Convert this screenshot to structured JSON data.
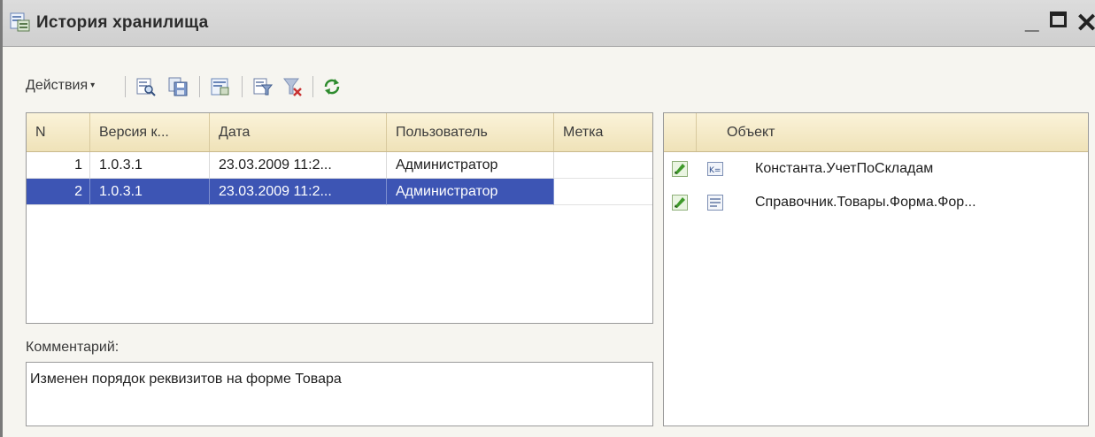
{
  "window": {
    "title": "История хранилища",
    "minimize": "_",
    "close": "✕"
  },
  "toolbar": {
    "actions_label": "Действия",
    "actions_caret": "▾",
    "icons": [
      "view-version-icon",
      "save-version-icon",
      "report-icon",
      "filter-icon",
      "clear-filter-icon",
      "refresh-icon"
    ]
  },
  "versions_table": {
    "columns": [
      "N",
      "Версия к...",
      "Дата",
      "Пользователь",
      "Метка"
    ],
    "rows": [
      {
        "n": "1",
        "version": "1.0.3.1",
        "date": "23.03.2009 11:2...",
        "user": "Администратор",
        "label": "",
        "selected": false
      },
      {
        "n": "2",
        "version": "1.0.3.1",
        "date": "23.03.2009 11:2...",
        "user": "Администратор",
        "label": "",
        "selected": true
      }
    ]
  },
  "comment": {
    "label": "Комментарий:",
    "text": "Изменен порядок реквизитов на форме Товара"
  },
  "objects_table": {
    "column": "Объект",
    "rows": [
      {
        "status_icon": "changed-icon",
        "type_icon": "constant-icon",
        "name": "Константа.УчетПоСкладам"
      },
      {
        "status_icon": "changed-icon",
        "type_icon": "form-icon",
        "name": "Справочник.Товары.Форма.Фор..."
      }
    ]
  },
  "colors": {
    "selection": "#3d55b4",
    "header_bg": "#f5ebc8",
    "window_bg": "#f6f5f0"
  }
}
